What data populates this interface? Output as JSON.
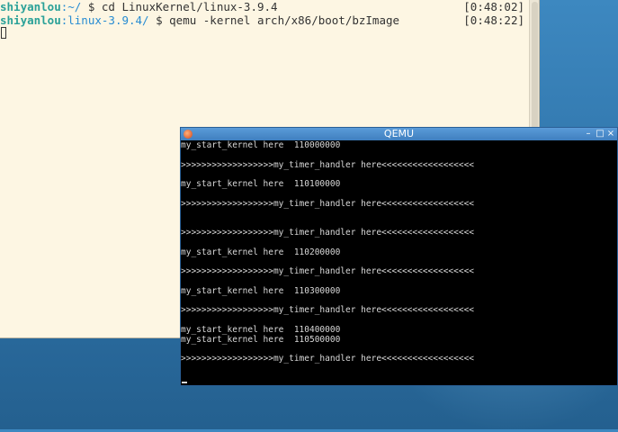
{
  "terminal": {
    "lines": [
      {
        "user": "shiyanlou",
        "path": ":~/",
        "command": " $ cd LinuxKernel/linux-3.9.4",
        "time": "[0:48:02]"
      },
      {
        "user": "shiyanlou",
        "path": ":linux-3.9.4/",
        "command": " $ qemu -kernel arch/x86/boot/bzImage",
        "time": "[0:48:22]"
      }
    ]
  },
  "qemu": {
    "title": "QEMU",
    "minimize": "–",
    "maximize": "□",
    "close": "×",
    "output": [
      "my_start_kernel here  110000000",
      ">>>>>>>>>>>>>>>>>>my_timer_handler here<<<<<<<<<<<<<<<<<<",
      "my_start_kernel here  110100000",
      ">>>>>>>>>>>>>>>>>>my_timer_handler here<<<<<<<<<<<<<<<<<<",
      ">>>>>>>>>>>>>>>>>>my_timer_handler here<<<<<<<<<<<<<<<<<<",
      "my_start_kernel here  110200000",
      ">>>>>>>>>>>>>>>>>>my_timer_handler here<<<<<<<<<<<<<<<<<<",
      "my_start_kernel here  110300000",
      ">>>>>>>>>>>>>>>>>>my_timer_handler here<<<<<<<<<<<<<<<<<<",
      "my_start_kernel here  110400000",
      "my_start_kernel here  110500000",
      ">>>>>>>>>>>>>>>>>>my_timer_handler here<<<<<<<<<<<<<<<<<<"
    ]
  }
}
